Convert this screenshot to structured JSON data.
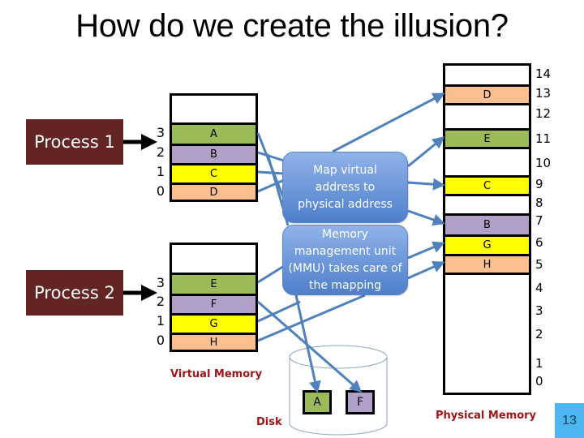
{
  "title": "How do we create the illusion?",
  "colors": {
    "process_bg": "#632523",
    "green": "#9bbb59",
    "purple": "#b1a0c7",
    "yellow": "#ffff00",
    "peach": "#fabf8f",
    "line_blue": "#4f81bd",
    "label_red": "#a01518",
    "slide_badge": "#4cb6ee"
  },
  "processes": [
    {
      "label": "Process 1",
      "pages": [
        {
          "index": "3",
          "content": "A",
          "color": "green"
        },
        {
          "index": "2",
          "content": "B",
          "color": "purple"
        },
        {
          "index": "1",
          "content": "C",
          "color": "yellow"
        },
        {
          "index": "0",
          "content": "D",
          "color": "peach"
        }
      ]
    },
    {
      "label": "Process 2",
      "pages": [
        {
          "index": "3",
          "content": "E",
          "color": "green"
        },
        {
          "index": "2",
          "content": "F",
          "color": "purple"
        },
        {
          "index": "1",
          "content": "G",
          "color": "yellow"
        },
        {
          "index": "0",
          "content": "H",
          "color": "peach"
        }
      ]
    }
  ],
  "virtual_memory_label": "Virtual Memory",
  "mmu": {
    "box1": "Map virtual address to physical address",
    "box2": "Memory management unit (MMU) takes care of the mapping"
  },
  "physical_memory": {
    "label": "Physical Memory",
    "frames": [
      {
        "number": "14",
        "content": "",
        "color": ""
      },
      {
        "number": "13",
        "content": "D",
        "color": "peach"
      },
      {
        "number": "12",
        "content": "",
        "color": ""
      },
      {
        "number": "11",
        "content": "E",
        "color": "green"
      },
      {
        "number": "10",
        "content": "",
        "color": ""
      },
      {
        "number": "9",
        "content": "C",
        "color": "yellow"
      },
      {
        "number": "8",
        "content": "",
        "color": ""
      },
      {
        "number": "7",
        "content": "B",
        "color": "purple"
      },
      {
        "number": "6",
        "content": "G",
        "color": "yellow"
      },
      {
        "number": "5",
        "content": "H",
        "color": "peach"
      },
      {
        "number": "4",
        "content": "",
        "color": ""
      },
      {
        "number": "3",
        "content": "",
        "color": ""
      },
      {
        "number": "2",
        "content": "",
        "color": ""
      },
      {
        "number": "1",
        "content": "",
        "color": ""
      },
      {
        "number": "0",
        "content": "",
        "color": ""
      }
    ]
  },
  "disk": {
    "label": "Disk",
    "blocks": [
      {
        "content": "A",
        "color": "green"
      },
      {
        "content": "F",
        "color": "purple"
      }
    ]
  },
  "slide_number": "13"
}
